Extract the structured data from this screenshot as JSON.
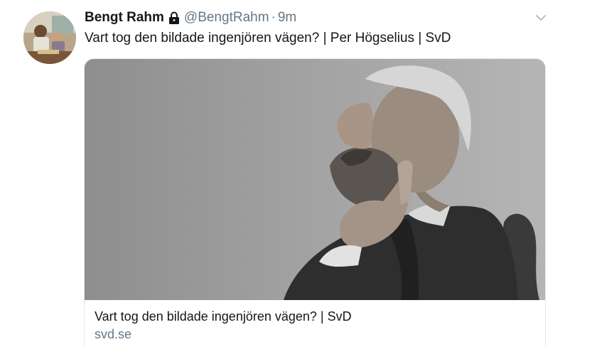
{
  "tweet": {
    "author_name": "Bengt Rahm",
    "handle": "@BengtRahm",
    "separator": "·",
    "time": "9m",
    "text": "Vart tog den bildade ingenjören vägen? | Per Högselius | SvD",
    "avatar_icon": "user-photo",
    "protected_icon": "lock-icon",
    "menu_icon": "chevron-down-icon"
  },
  "card": {
    "title": "Vart tog den bildade ingenjören vägen? | SvD",
    "domain": "svd.se"
  },
  "colors": {
    "text_primary": "#14171a",
    "text_secondary": "#657786",
    "border": "#e1e8ed"
  }
}
